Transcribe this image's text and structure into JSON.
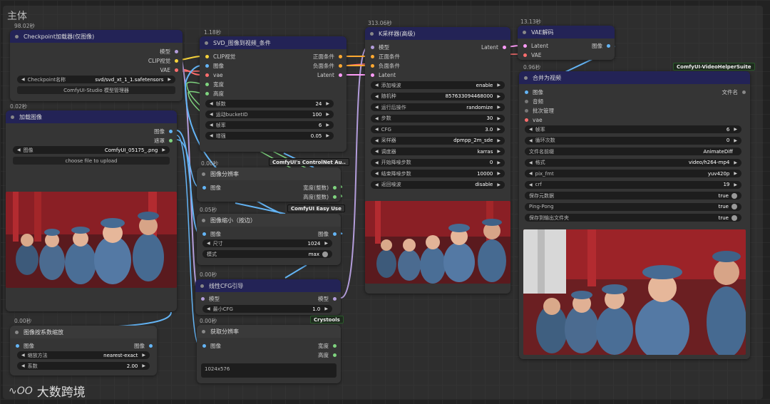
{
  "group_title": "主体",
  "colors": {
    "clip": "#f5d23b",
    "image": "#64b5f6",
    "vae": "#ff6e6e",
    "model": "#b39ddb",
    "latent": "#ff9cf9",
    "conditioning": "#ffa931",
    "int": "#7fd47f"
  },
  "nodes": {
    "checkpoint": {
      "timing": "98.02秒",
      "title": "Checkpoint加载器(仅图像)",
      "outputs": [
        "模型",
        "CLIP视觉",
        "VAE"
      ],
      "ckpt_label": "Checkpoint名称",
      "ckpt_value": "svd/svd_xt_1_1.safetensors",
      "manager_btn": "ComfyUI-Studio 模型管理器"
    },
    "load_image": {
      "timing": "0.02秒",
      "title": "加载图像",
      "outputs": [
        "图像",
        "遮罩"
      ],
      "image_label": "图像",
      "image_value": "ComfyUI_05175_.png",
      "upload_btn": "choose file to upload"
    },
    "svd_cond": {
      "timing": "1.18秒",
      "title": "SVD_图像到视频_条件",
      "inputs": [
        "CLIP视觉",
        "图像",
        "vae",
        "宽度",
        "高度"
      ],
      "outputs": [
        "正面条件",
        "负面条件",
        "Latent"
      ],
      "widgets": [
        {
          "label": "帧数",
          "value": "24"
        },
        {
          "label": "运动bucketID",
          "value": "100"
        },
        {
          "label": "帧率",
          "value": "6"
        },
        {
          "label": "增强",
          "value": "0.05"
        }
      ]
    },
    "image_res": {
      "timing": "0.00秒",
      "title": "图像分辨率",
      "inputs": [
        "图像"
      ],
      "outputs": [
        "宽度(整数)",
        "高度(整数)"
      ]
    },
    "image_scale": {
      "timing": "0.05秒",
      "title": "图像缩小（按边）",
      "inputs": [
        "图像"
      ],
      "outputs": [
        "图像"
      ],
      "widgets": [
        {
          "label": "尺寸",
          "value": "1024"
        },
        {
          "label": "模式",
          "value": "max"
        }
      ]
    },
    "cfg_guide": {
      "timing": "0.00秒",
      "title": "线性CFG引导",
      "inputs": [
        "模型"
      ],
      "outputs": [
        "模型"
      ],
      "widgets": [
        {
          "label": "最小CFG",
          "value": "1.0"
        }
      ]
    },
    "get_res": {
      "timing": "0.00秒",
      "title": "获取分辨率",
      "inputs": [
        "图像"
      ],
      "outputs": [
        "宽度",
        "高度"
      ],
      "text": "1024x576"
    },
    "image_scale_factor": {
      "timing": "0.00秒",
      "title": "图像按系数缩放",
      "inputs": [
        "图像"
      ],
      "outputs": [
        "图像"
      ],
      "widgets": [
        {
          "label": "缩放方法",
          "value": "nearest-exact"
        },
        {
          "label": "系数",
          "value": "2.00"
        }
      ]
    },
    "ksampler": {
      "timing": "313.06秒",
      "title": "K采样器(高级)",
      "inputs": [
        "模型",
        "正面条件",
        "负面条件",
        "Latent"
      ],
      "outputs": [
        "Latent"
      ],
      "widgets": [
        {
          "label": "添加噪波",
          "value": "enable"
        },
        {
          "label": "随机种",
          "value": "857633094468000"
        },
        {
          "label": "运行后操作",
          "value": "randomize"
        },
        {
          "label": "步数",
          "value": "30"
        },
        {
          "label": "CFG",
          "value": "3.0"
        },
        {
          "label": "采样器",
          "value": "dpmpp_2m_sde"
        },
        {
          "label": "调度器",
          "value": "karras"
        },
        {
          "label": "开始降噪步数",
          "value": "0"
        },
        {
          "label": "结束降噪步数",
          "value": "10000"
        },
        {
          "label": "返回噪波",
          "value": "disable"
        }
      ]
    },
    "vae_decode": {
      "timing": "13.13秒",
      "title": "VAE解码",
      "inputs": [
        "Latent",
        "VAE"
      ],
      "outputs": [
        "图像"
      ]
    },
    "video_combine": {
      "timing": "0.96秒",
      "title": "合并为视频",
      "inputs": [
        "图像",
        "音频",
        "批次管理",
        "vae"
      ],
      "outputs": [
        "文件名"
      ],
      "widgets": [
        {
          "label": "帧率",
          "value": "6",
          "type": "num"
        },
        {
          "label": "循环次数",
          "value": "0",
          "type": "num"
        },
        {
          "label": "文件名前缀",
          "value": "AnimateDiff",
          "type": "text"
        },
        {
          "label": "格式",
          "value": "video/h264-mp4",
          "type": "num"
        },
        {
          "label": "pix_fmt",
          "value": "yuv420p",
          "type": "num"
        },
        {
          "label": "crf",
          "value": "19",
          "type": "num"
        },
        {
          "label": "保存元数据",
          "value": "true",
          "type": "toggle"
        },
        {
          "label": "Ping-Pong",
          "value": "true",
          "type": "toggle"
        },
        {
          "label": "保存到输出文件夹",
          "value": "true",
          "type": "toggle"
        }
      ]
    }
  },
  "badges": {
    "controlnet": "ComfyUI's ControlNet Au..",
    "easy_use": "ComfyUI Easy Use",
    "crystools": "Crystools",
    "vhs": "ComfyUI-VideoHelperSuite"
  },
  "watermark": "大数跨境"
}
